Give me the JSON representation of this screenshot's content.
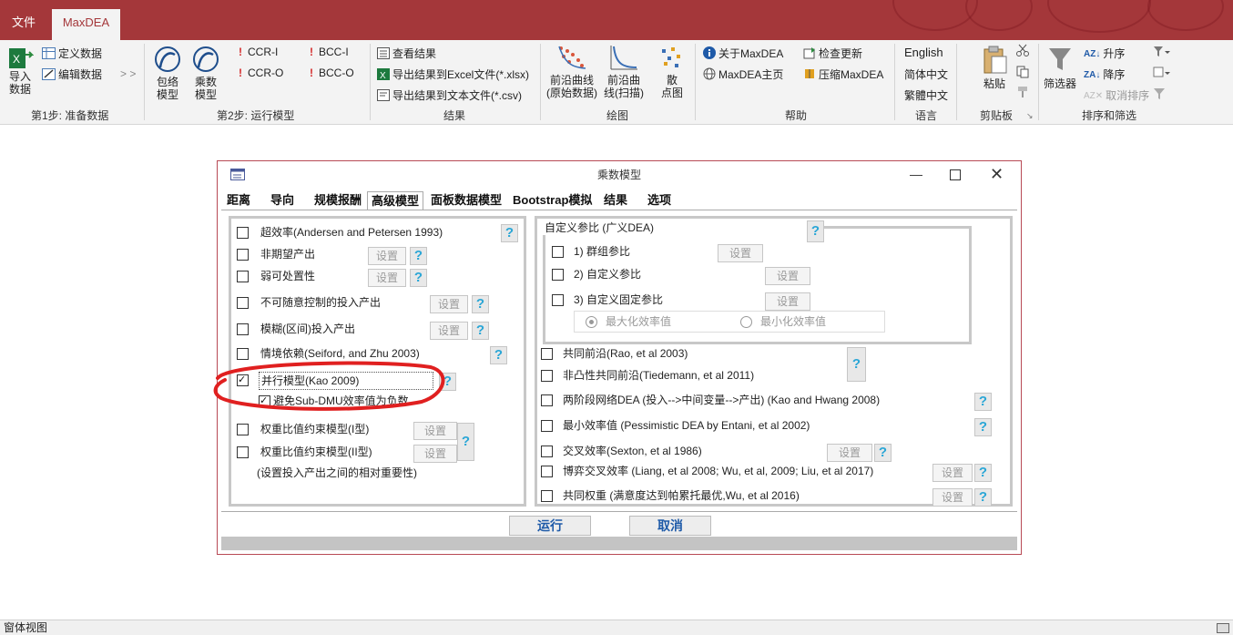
{
  "app": {
    "tabs": [
      {
        "label": "文件"
      },
      {
        "label": "MaxDEA"
      }
    ]
  },
  "ribbon": {
    "step1": {
      "import": "导入\n数据",
      "define": "定义数据",
      "edit": "编辑数据",
      "more": "> >",
      "group": "第1步: 准备数据"
    },
    "step2": {
      "envelope": "包络\n模型",
      "multiplier": "乘数\n模型",
      "ccr_i": "CCR-I",
      "ccr_o": "CCR-O",
      "bcc_i": "BCC-I",
      "bcc_o": "BCC-O",
      "group": "第2步: 运行模型"
    },
    "results": {
      "view": "查看结果",
      "export_excel": "导出结果到Excel文件(*.xlsx)",
      "export_text": "导出结果到文本文件(*.csv)",
      "group": "结果"
    },
    "plot": {
      "frontier_raw": "前沿曲线\n(原始数据)",
      "frontier_scan": "前沿曲\n线(扫描)",
      "scatter": "散\n点图",
      "group": "绘图"
    },
    "help": {
      "about": "关于MaxDEA",
      "home": "MaxDEA主页",
      "update": "检查更新",
      "compress": "压缩MaxDEA",
      "group": "帮助"
    },
    "language": {
      "en": "English",
      "zh_s": "简体中文",
      "zh_t": "繁體中文",
      "group": "语言"
    },
    "clipboard": {
      "paste": "粘贴",
      "group": "剪贴板"
    },
    "sort": {
      "filter": "筛选器",
      "asc": "升序",
      "desc": "降序",
      "cancel": "取消排序",
      "group": "排序和筛选"
    }
  },
  "dialog": {
    "title": "乘数模型",
    "tabs": [
      {
        "label": "距离"
      },
      {
        "label": "导向"
      },
      {
        "label": "规模报酬"
      },
      {
        "label": "高级模型"
      },
      {
        "label": "面板数据模型"
      },
      {
        "label": "Bootstrap模拟"
      },
      {
        "label": "结果"
      },
      {
        "label": "选项"
      }
    ],
    "left": {
      "super": "超效率(Andersen and Petersen 1993)",
      "undesirable": "非期望产出",
      "weak": "弱可处置性",
      "noncontrol": "不可随意控制的投入产出",
      "fuzzy": "模糊(区间)投入产出",
      "context": "情境依赖(Seiford, and Zhu 2003)",
      "parallel": "并行模型(Kao 2009)",
      "subdmu": "避免Sub-DMU效率值为负数",
      "ar1": "权重比值约束模型(I型)",
      "ar2": "权重比值约束模型(II型)",
      "ar_note": "(设置投入产出之间的相对重要性)",
      "set": "设置",
      "q": "?"
    },
    "right": {
      "custom_title": "自定义参比 (广义DEA)",
      "group_ref": "1) 群组参比",
      "custom_ref": "2) 自定义参比",
      "fixed_ref": "3) 自定义固定参比",
      "max_eff": "最大化效率值",
      "min_eff": "最小化效率值",
      "metafrontier": "共同前沿(Rao, et al 2003)",
      "nonconvex_meta": "非凸性共同前沿(Tiedemann, et al 2011)",
      "two_stage": "两阶段网络DEA (投入-->中间变量-->产出) (Kao and Hwang 2008)",
      "pessimistic": "最小效率值 (Pessimistic DEA by Entani, et al 2002)",
      "cross": "交叉效率(Sexton, et al 1986)",
      "game_cross": "博弈交叉效率 (Liang, et al 2008; Wu, et al, 2009; Liu, et al 2017)",
      "common_weights": "共同权重 (满意度达到帕累托最优,Wu, et al 2016)"
    },
    "run": "运行",
    "cancel": "取消"
  },
  "status": {
    "text": "窗体视图"
  },
  "colors": {
    "titlebar": "#a4373a",
    "annotation": "#e02020",
    "help_blue": "#2aa6d6"
  }
}
